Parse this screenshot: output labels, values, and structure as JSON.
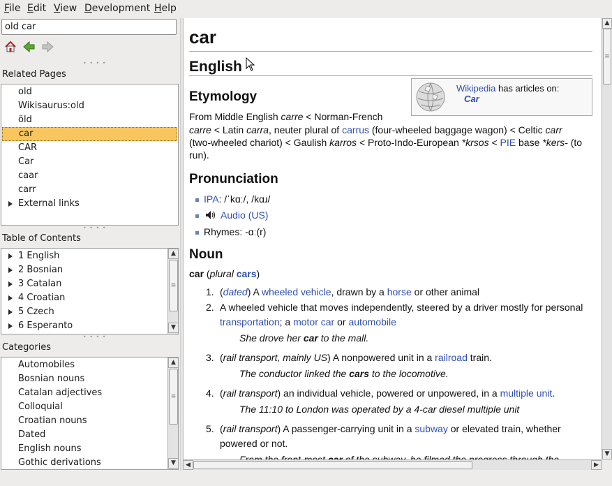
{
  "menu": {
    "file": {
      "u": "F",
      "rest": "ile"
    },
    "edit": {
      "u": "E",
      "rest": "dit"
    },
    "view": {
      "u": "V",
      "rest": "iew"
    },
    "development": {
      "u": "D",
      "rest": "evelopment"
    },
    "help": {
      "u": "H",
      "rest": "elp"
    }
  },
  "search": {
    "value": "old car"
  },
  "related": {
    "title": "Related Pages",
    "items": [
      "old",
      "Wikisaurus:old",
      "öld",
      "car",
      "CAR",
      "Car",
      "caar",
      "carr",
      "External links"
    ]
  },
  "toc": {
    "title": "Table of Contents",
    "items": [
      "1 English",
      "2 Bosnian",
      "3 Catalan",
      "4 Croatian",
      "5 Czech",
      "6 Esperanto"
    ]
  },
  "categories": {
    "title": "Categories",
    "items": [
      "Automobiles",
      "Bosnian nouns",
      "Catalan adjectives",
      "Colloquial",
      "Croatian nouns",
      "Dated",
      "English nouns",
      "Gothic derivations"
    ]
  },
  "article": {
    "title": "car",
    "language": "English",
    "wikibox": {
      "link": "Wikipedia",
      "text": " has articles on:",
      "article": "Car"
    },
    "etymology": {
      "heading": "Etymology",
      "l1": [
        "From Middle English ",
        "carre",
        " < Norman-French"
      ],
      "l2": [
        "carre",
        " < Latin ",
        "carra",
        ", neuter plural of ",
        "carrus",
        " (four-wheeled baggage wagon) < Celtic ",
        "carr"
      ],
      "l3": [
        "(two-wheeled chariot) < Gaulish ",
        "karros",
        " < Proto-Indo-European ",
        "*krsos",
        " < ",
        "PIE",
        " base ",
        "*kers-",
        " (to"
      ],
      "l4": "run)."
    },
    "pronunciation": {
      "heading": "Pronunciation",
      "ipa_link": "IPA",
      "ipa_text": ": /ˈkɑː/, /kɑɹ/",
      "audio": "Audio (US)",
      "rhymes": "Rhymes: -ɑː(r)"
    },
    "noun": {
      "heading": "Noun",
      "head": [
        "car",
        " (",
        "plural",
        " ",
        "cars",
        ")"
      ],
      "d1": [
        "1.",
        "(",
        "dated",
        ") A ",
        "wheeled vehicle",
        ", drawn by a ",
        "horse",
        " or other animal"
      ],
      "d2a": [
        "2.",
        "A wheeled vehicle that moves independently, steered by a driver mostly for personal"
      ],
      "d2b": [
        "transportation",
        "; a ",
        "motor car",
        " or ",
        "automobile"
      ],
      "d2ex": [
        "She drove her ",
        "car",
        " to the mall."
      ],
      "d3": [
        "3.",
        "(",
        "rail transport, mainly US",
        ") A nonpowered unit in a ",
        "railroad",
        " train."
      ],
      "d3ex": [
        "The conductor linked the ",
        "cars",
        " to the locomotive."
      ],
      "d4": [
        "4.",
        "(",
        "rail transport",
        ") an individual vehicle, powered or unpowered, in a ",
        "multiple unit",
        "."
      ],
      "d4ex": "The 11:10 to London was operated by a 4-car diesel multiple unit",
      "d5a": [
        "5.",
        "(",
        "rail transport",
        ") A passenger-carrying unit in a ",
        "subway",
        " or elevated train, whether"
      ],
      "d5b": "powered or not.",
      "d5ex": [
        "From the front-most ",
        "car",
        " of the subway, he filmed the progress through the"
      ]
    }
  },
  "colors": {
    "selection": "#f9c55e",
    "link": "#2f4fb0"
  }
}
